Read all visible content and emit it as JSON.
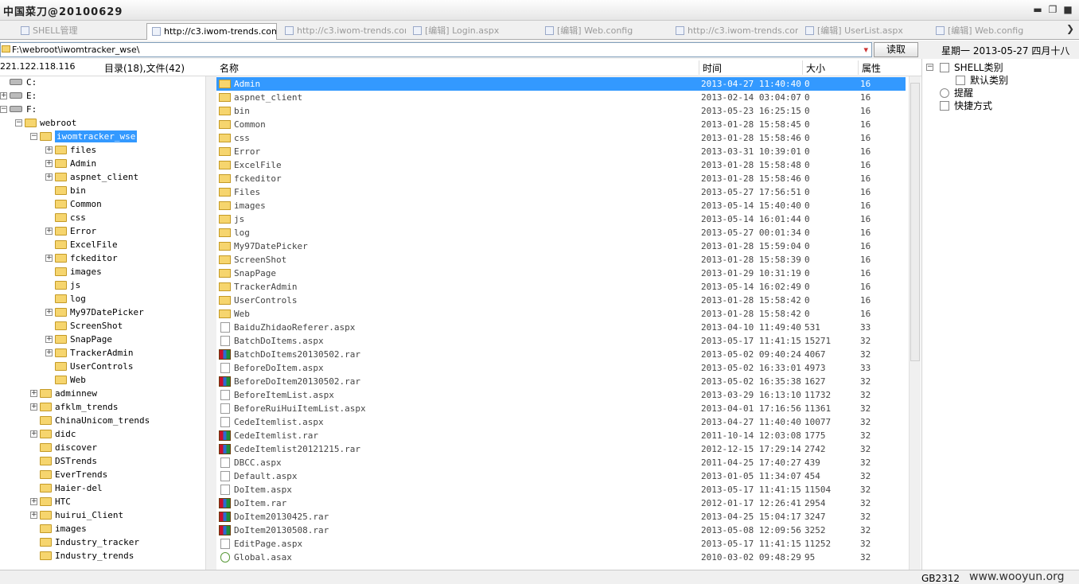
{
  "window": {
    "title": "中国菜刀@20100629"
  },
  "tabs": [
    {
      "label": "SHELL管理",
      "active": false
    },
    {
      "label": "http://c3.iwom-trends.com",
      "active": true
    },
    {
      "label": "http://c3.iwom-trends.com...",
      "active": false
    },
    {
      "label": "[编辑] Login.aspx",
      "active": false
    },
    {
      "label": "[编辑] Web.config",
      "active": false
    },
    {
      "label": "http://c3.iwom-trends.com...",
      "active": false
    },
    {
      "label": "[编辑] UserList.aspx",
      "active": false
    },
    {
      "label": "[编辑] Web.config",
      "active": false
    }
  ],
  "address": {
    "path": "F:\\webroot\\iwomtracker_wse\\",
    "read_button": "读取",
    "date": "星期一 2013-05-27 四月十八"
  },
  "subheader": {
    "ip": "221.122.118.116",
    "counts": "目录(18),文件(42)",
    "col_name": "名称",
    "col_time": "时间",
    "col_size": "大小",
    "col_attr": "属性"
  },
  "tree": [
    {
      "label": "C:",
      "level": 0,
      "type": "drive",
      "exp": ""
    },
    {
      "label": "E:",
      "level": 0,
      "type": "drive",
      "exp": "+"
    },
    {
      "label": "F:",
      "level": 0,
      "type": "drive",
      "exp": "-"
    },
    {
      "label": "webroot",
      "level": 1,
      "type": "folder",
      "exp": "-"
    },
    {
      "label": "iwomtracker_wse",
      "level": 2,
      "type": "folder",
      "exp": "-",
      "selected": true
    },
    {
      "label": "files",
      "level": 3,
      "type": "folder",
      "exp": "+"
    },
    {
      "label": "Admin",
      "level": 3,
      "type": "folder",
      "exp": "+"
    },
    {
      "label": "aspnet_client",
      "level": 3,
      "type": "folder",
      "exp": "+"
    },
    {
      "label": "bin",
      "level": 3,
      "type": "folder",
      "exp": ""
    },
    {
      "label": "Common",
      "level": 3,
      "type": "folder",
      "exp": ""
    },
    {
      "label": "css",
      "level": 3,
      "type": "folder",
      "exp": ""
    },
    {
      "label": "Error",
      "level": 3,
      "type": "folder",
      "exp": "+"
    },
    {
      "label": "ExcelFile",
      "level": 3,
      "type": "folder",
      "exp": ""
    },
    {
      "label": "fckeditor",
      "level": 3,
      "type": "folder",
      "exp": "+"
    },
    {
      "label": "images",
      "level": 3,
      "type": "folder",
      "exp": ""
    },
    {
      "label": "js",
      "level": 3,
      "type": "folder",
      "exp": ""
    },
    {
      "label": "log",
      "level": 3,
      "type": "folder",
      "exp": ""
    },
    {
      "label": "My97DatePicker",
      "level": 3,
      "type": "folder",
      "exp": "+"
    },
    {
      "label": "ScreenShot",
      "level": 3,
      "type": "folder",
      "exp": ""
    },
    {
      "label": "SnapPage",
      "level": 3,
      "type": "folder",
      "exp": "+"
    },
    {
      "label": "TrackerAdmin",
      "level": 3,
      "type": "folder",
      "exp": "+"
    },
    {
      "label": "UserControls",
      "level": 3,
      "type": "folder",
      "exp": ""
    },
    {
      "label": "Web",
      "level": 3,
      "type": "folder",
      "exp": ""
    },
    {
      "label": "adminnew",
      "level": 2,
      "type": "folder",
      "exp": "+"
    },
    {
      "label": "afklm_trends",
      "level": 2,
      "type": "folder",
      "exp": "+"
    },
    {
      "label": "ChinaUnicom_trends",
      "level": 2,
      "type": "folder",
      "exp": ""
    },
    {
      "label": "didc",
      "level": 2,
      "type": "folder",
      "exp": "+"
    },
    {
      "label": "discover",
      "level": 2,
      "type": "folder",
      "exp": ""
    },
    {
      "label": "DSTrends",
      "level": 2,
      "type": "folder",
      "exp": ""
    },
    {
      "label": "EverTrends",
      "level": 2,
      "type": "folder",
      "exp": ""
    },
    {
      "label": "Haier-del",
      "level": 2,
      "type": "folder",
      "exp": ""
    },
    {
      "label": "HTC",
      "level": 2,
      "type": "folder",
      "exp": "+"
    },
    {
      "label": "huirui_Client",
      "level": 2,
      "type": "folder",
      "exp": "+"
    },
    {
      "label": "images",
      "level": 2,
      "type": "folder",
      "exp": ""
    },
    {
      "label": "Industry_tracker",
      "level": 2,
      "type": "folder",
      "exp": ""
    },
    {
      "label": "Industry_trends",
      "level": 2,
      "type": "folder",
      "exp": ""
    }
  ],
  "files": [
    {
      "name": "Admin",
      "time": "2013-04-27 11:40:40",
      "size": "0",
      "attr": "16",
      "icon": "folder",
      "selected": true
    },
    {
      "name": "aspnet_client",
      "time": "2013-02-14 03:04:07",
      "size": "0",
      "attr": "16",
      "icon": "folder"
    },
    {
      "name": "bin",
      "time": "2013-05-23 16:25:15",
      "size": "0",
      "attr": "16",
      "icon": "folder"
    },
    {
      "name": "Common",
      "time": "2013-01-28 15:58:45",
      "size": "0",
      "attr": "16",
      "icon": "folder"
    },
    {
      "name": "css",
      "time": "2013-01-28 15:58:46",
      "size": "0",
      "attr": "16",
      "icon": "folder"
    },
    {
      "name": "Error",
      "time": "2013-03-31 10:39:01",
      "size": "0",
      "attr": "16",
      "icon": "folder"
    },
    {
      "name": "ExcelFile",
      "time": "2013-01-28 15:58:48",
      "size": "0",
      "attr": "16",
      "icon": "folder"
    },
    {
      "name": "fckeditor",
      "time": "2013-01-28 15:58:46",
      "size": "0",
      "attr": "16",
      "icon": "folder"
    },
    {
      "name": "Files",
      "time": "2013-05-27 17:56:51",
      "size": "0",
      "attr": "16",
      "icon": "folder"
    },
    {
      "name": "images",
      "time": "2013-05-14 15:40:40",
      "size": "0",
      "attr": "16",
      "icon": "folder"
    },
    {
      "name": "js",
      "time": "2013-05-14 16:01:44",
      "size": "0",
      "attr": "16",
      "icon": "folder"
    },
    {
      "name": "log",
      "time": "2013-05-27 00:01:34",
      "size": "0",
      "attr": "16",
      "icon": "folder"
    },
    {
      "name": "My97DatePicker",
      "time": "2013-01-28 15:59:04",
      "size": "0",
      "attr": "16",
      "icon": "folder"
    },
    {
      "name": "ScreenShot",
      "time": "2013-01-28 15:58:39",
      "size": "0",
      "attr": "16",
      "icon": "folder"
    },
    {
      "name": "SnapPage",
      "time": "2013-01-29 10:31:19",
      "size": "0",
      "attr": "16",
      "icon": "folder"
    },
    {
      "name": "TrackerAdmin",
      "time": "2013-05-14 16:02:49",
      "size": "0",
      "attr": "16",
      "icon": "folder"
    },
    {
      "name": "UserControls",
      "time": "2013-01-28 15:58:42",
      "size": "0",
      "attr": "16",
      "icon": "folder"
    },
    {
      "name": "Web",
      "time": "2013-01-28 15:58:42",
      "size": "0",
      "attr": "16",
      "icon": "folder"
    },
    {
      "name": "BaiduZhidaoReferer.aspx",
      "time": "2013-04-10 11:49:40",
      "size": "531",
      "attr": "33",
      "icon": "file"
    },
    {
      "name": "BatchDoItems.aspx",
      "time": "2013-05-17 11:41:15",
      "size": "15271",
      "attr": "32",
      "icon": "file"
    },
    {
      "name": "BatchDoItems20130502.rar",
      "time": "2013-05-02 09:40:24",
      "size": "4067",
      "attr": "32",
      "icon": "rar"
    },
    {
      "name": "BeforeDoItem.aspx",
      "time": "2013-05-02 16:33:01",
      "size": "4973",
      "attr": "33",
      "icon": "file"
    },
    {
      "name": "BeforeDoItem20130502.rar",
      "time": "2013-05-02 16:35:38",
      "size": "1627",
      "attr": "32",
      "icon": "rar"
    },
    {
      "name": "BeforeItemList.aspx",
      "time": "2013-03-29 16:13:10",
      "size": "11732",
      "attr": "32",
      "icon": "file"
    },
    {
      "name": "BeforeRuiHuiItemList.aspx",
      "time": "2013-04-01 17:16:56",
      "size": "11361",
      "attr": "32",
      "icon": "file"
    },
    {
      "name": "CedeItemlist.aspx",
      "time": "2013-04-27 11:40:40",
      "size": "10077",
      "attr": "32",
      "icon": "file"
    },
    {
      "name": "CedeItemlist.rar",
      "time": "2011-10-14 12:03:08",
      "size": "1775",
      "attr": "32",
      "icon": "rar"
    },
    {
      "name": "CedeItemlist20121215.rar",
      "time": "2012-12-15 17:29:14",
      "size": "2742",
      "attr": "32",
      "icon": "rar"
    },
    {
      "name": "DBCC.aspx",
      "time": "2011-04-25 17:40:27",
      "size": "439",
      "attr": "32",
      "icon": "file"
    },
    {
      "name": "Default.aspx",
      "time": "2013-01-05 11:34:07",
      "size": "454",
      "attr": "32",
      "icon": "file"
    },
    {
      "name": "DoItem.aspx",
      "time": "2013-05-17 11:41:15",
      "size": "11504",
      "attr": "32",
      "icon": "file"
    },
    {
      "name": "DoItem.rar",
      "time": "2012-01-17 12:26:41",
      "size": "2954",
      "attr": "32",
      "icon": "rar"
    },
    {
      "name": "DoItem20130425.rar",
      "time": "2013-04-25 15:04:17",
      "size": "3247",
      "attr": "32",
      "icon": "rar"
    },
    {
      "name": "DoItem20130508.rar",
      "time": "2013-05-08 12:09:56",
      "size": "3252",
      "attr": "32",
      "icon": "rar"
    },
    {
      "name": "EditPage.aspx",
      "time": "2013-05-17 11:41:15",
      "size": "11252",
      "attr": "32",
      "icon": "file"
    },
    {
      "name": "Global.asax",
      "time": "2010-03-02 09:48:29",
      "size": "95",
      "attr": "32",
      "icon": "asax"
    }
  ],
  "right_panel": [
    {
      "label": "SHELL类别",
      "exp": "-"
    },
    {
      "label": "默认类别",
      "exp": ""
    },
    {
      "label": "提醒",
      "exp": ""
    },
    {
      "label": "快捷方式",
      "exp": ""
    }
  ],
  "status": {
    "encoding": "GB2312",
    "watermark": "www.wooyun.org"
  }
}
